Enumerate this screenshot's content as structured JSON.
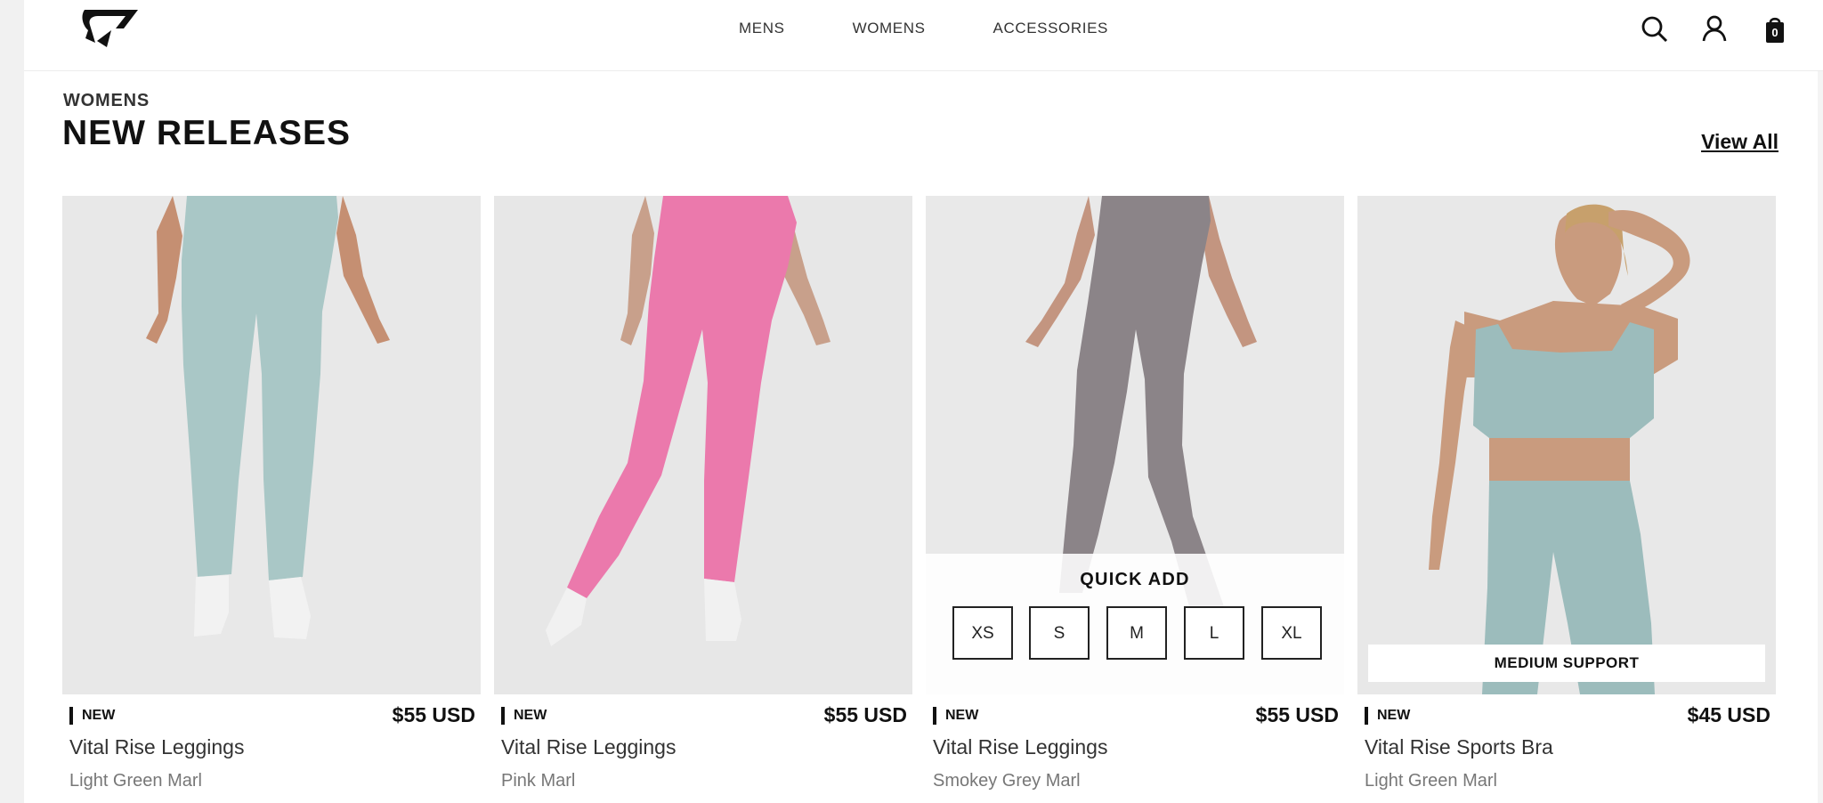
{
  "header": {
    "nav": [
      "MENS",
      "WOMENS",
      "ACCESSORIES"
    ],
    "cart_count": "0",
    "icons": [
      "gymshark-logo",
      "search-icon",
      "account-icon",
      "bag-icon"
    ]
  },
  "section": {
    "kicker": "WOMENS",
    "title": "NEW RELEASES",
    "view_all": "View All"
  },
  "products": [
    {
      "badge": "NEW",
      "price": "$55 USD",
      "name": "Vital Rise Leggings",
      "color": "Light Green Marl",
      "swatch": "#9cbcbc"
    },
    {
      "badge": "NEW",
      "price": "$55 USD",
      "name": "Vital Rise Leggings",
      "color": "Pink Marl",
      "swatch": "#ec6fa5"
    },
    {
      "badge": "NEW",
      "price": "$55 USD",
      "name": "Vital Rise Leggings",
      "color": "Smokey Grey Marl",
      "swatch": "#858085"
    },
    {
      "badge": "NEW",
      "price": "$45 USD",
      "name": "Vital Rise Sports Bra",
      "color": "Light Green Marl",
      "swatch": "#9cbcbc",
      "overlay": "MEDIUM SUPPORT"
    }
  ],
  "quick_add": {
    "title": "QUICK ADD",
    "sizes": [
      "XS",
      "S",
      "M",
      "L",
      "XL"
    ]
  }
}
